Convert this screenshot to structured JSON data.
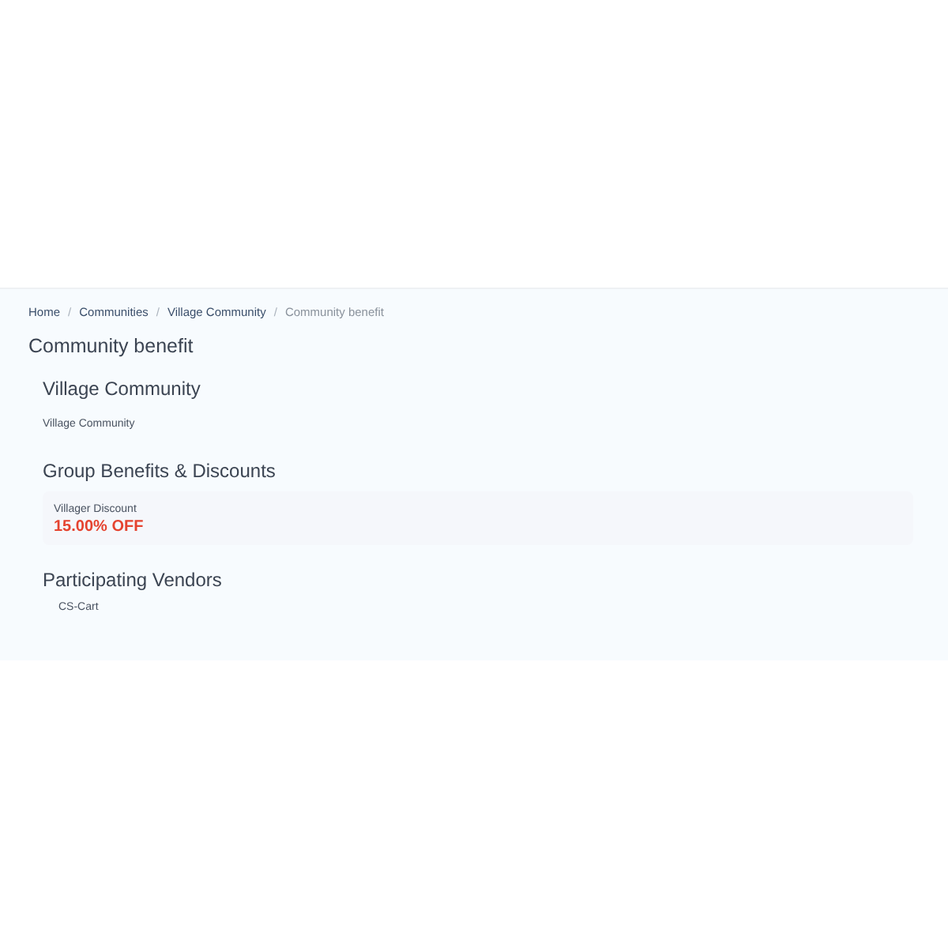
{
  "breadcrumb_separator": "/",
  "breadcrumb": [
    {
      "label": "Home",
      "current": false
    },
    {
      "label": "Communities",
      "current": false
    },
    {
      "label": "Village Community",
      "current": false
    },
    {
      "label": "Community benefit",
      "current": true
    }
  ],
  "page_title": "Community benefit",
  "community": {
    "heading": "Village Community",
    "name": "Village Community"
  },
  "benefits": {
    "heading": "Group Benefits & Discounts",
    "items": [
      {
        "name": "Villager Discount",
        "value": "15.00% OFF"
      }
    ]
  },
  "vendors": {
    "heading": "Participating Vendors",
    "items": [
      "CS-Cart"
    ]
  }
}
